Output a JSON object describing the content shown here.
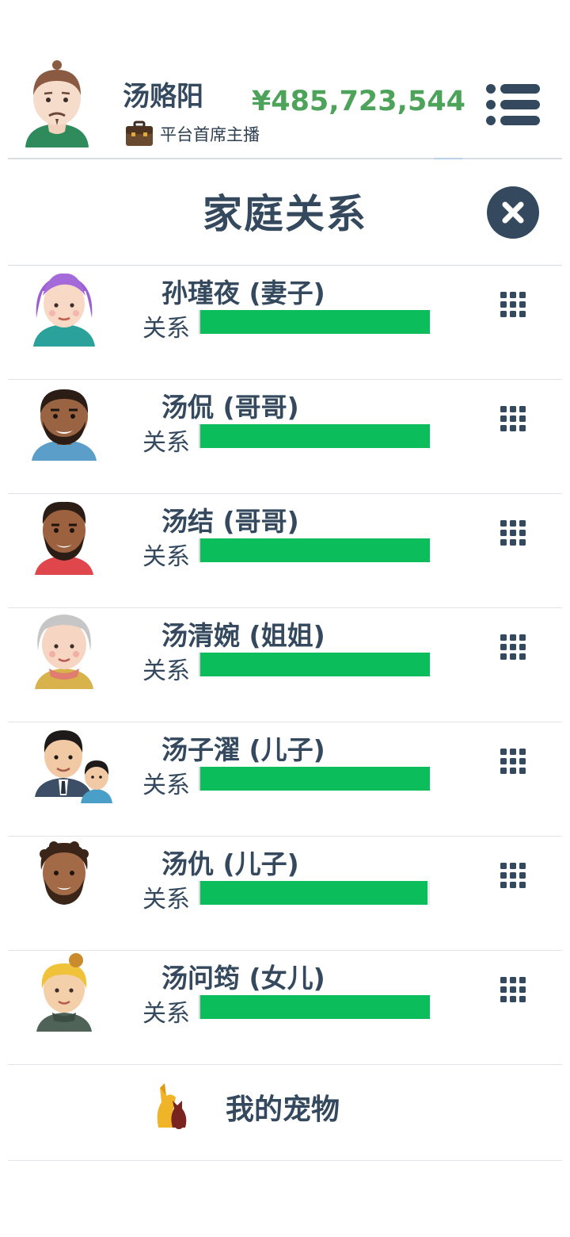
{
  "header": {
    "player_name": "汤赂阳",
    "player_title": "平台首席主播",
    "money": "¥485,723,544"
  },
  "modal": {
    "title": "家庭关系"
  },
  "relationship_label": "关系",
  "members": [
    {
      "name": "孙瑾夜 (妻子)",
      "relationship_level": 1.0
    },
    {
      "name": "汤侃 (哥哥)",
      "relationship_level": 1.0
    },
    {
      "name": "汤结 (哥哥)",
      "relationship_level": 1.0
    },
    {
      "name": "汤清婉 (姐姐)",
      "relationship_level": 1.0
    },
    {
      "name": "汤子濯 (儿子)",
      "relationship_level": 1.0
    },
    {
      "name": "汤仇 (儿子)",
      "relationship_level": 0.99
    },
    {
      "name": "汤问筠 (女儿)",
      "relationship_level": 1.0
    }
  ],
  "pets": {
    "label": "我的宠物"
  },
  "colors": {
    "money": "#4ea35a",
    "bar": "#0bbd5b",
    "text": "#34495e"
  }
}
